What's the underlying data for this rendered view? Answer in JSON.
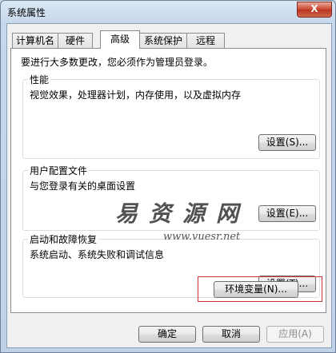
{
  "window": {
    "title": "系统属性",
    "close_glyph": "X"
  },
  "tabs": [
    {
      "label": "计算机名"
    },
    {
      "label": "硬件"
    },
    {
      "label": "高级"
    },
    {
      "label": "系统保护"
    },
    {
      "label": "远程"
    }
  ],
  "active_tab": "高级",
  "notice": "要进行大多数更改，您必须作为管理员登录。",
  "groups": {
    "performance": {
      "title": "性能",
      "description": "视觉效果，处理器计划，内存使用，以及虚拟内存",
      "button": "设置(S)..."
    },
    "user_profiles": {
      "title": "用户配置文件",
      "description": "与您登录有关的桌面设置",
      "button": "设置(E)..."
    },
    "startup_recovery": {
      "title": "启动和故障恢复",
      "description": "系统启动、系统失败和调试信息",
      "button": "设置(T)..."
    }
  },
  "env_button": "环境变量(N)...",
  "footer": {
    "ok": "确定",
    "cancel": "取消",
    "apply": "应用(A)"
  },
  "watermark": {
    "text": "易资源网",
    "url": "www.vuesr.net"
  }
}
